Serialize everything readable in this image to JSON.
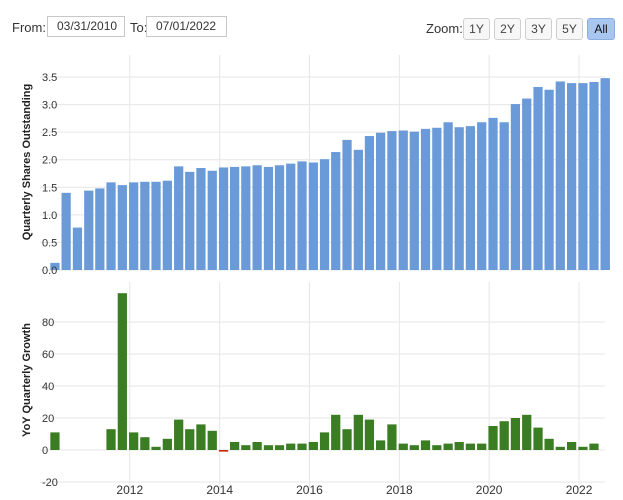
{
  "toolbar": {
    "from_label": "From:",
    "from_value": "03/31/2010",
    "to_label": "To:",
    "to_value": "07/01/2022",
    "zoom_label": "Zoom:",
    "zoom_buttons": [
      "1Y",
      "2Y",
      "3Y",
      "5Y",
      "All"
    ],
    "zoom_selected": "All"
  },
  "colors": {
    "shares_bar": "#6a9bd8",
    "growth_positive": "#3a7d22",
    "growth_negative": "#cc2200",
    "grid": "#e6e6e6"
  },
  "chart_data": [
    {
      "type": "bar",
      "ylabel": "Quarterly Shares Outstanding",
      "ylim": [
        0,
        3.9
      ],
      "yticks": [
        "0.0",
        "0.5",
        "1.0",
        "1.5",
        "2.0",
        "2.5",
        "3.0",
        "3.5"
      ],
      "x": [
        "2010-03-31",
        "2010-06-30",
        "2010-09-30",
        "2010-12-31",
        "2011-03-31",
        "2011-06-30",
        "2011-09-30",
        "2011-12-31",
        "2012-03-31",
        "2012-06-30",
        "2012-09-30",
        "2012-12-31",
        "2013-03-31",
        "2013-06-30",
        "2013-09-30",
        "2013-12-31",
        "2014-03-31",
        "2014-06-30",
        "2014-09-30",
        "2014-12-31",
        "2015-03-31",
        "2015-06-30",
        "2015-09-30",
        "2015-12-31",
        "2016-03-31",
        "2016-06-30",
        "2016-09-30",
        "2016-12-31",
        "2017-03-31",
        "2017-06-30",
        "2017-09-30",
        "2017-12-31",
        "2018-03-31",
        "2018-06-30",
        "2018-09-30",
        "2018-12-31",
        "2019-03-31",
        "2019-06-30",
        "2019-09-30",
        "2019-12-31",
        "2020-03-31",
        "2020-06-30",
        "2020-09-30",
        "2020-12-31",
        "2021-03-31",
        "2021-06-30",
        "2021-09-30",
        "2021-12-31",
        "2022-03-31",
        "2022-06-30"
      ],
      "values": [
        0.13,
        1.4,
        0.77,
        1.44,
        1.48,
        1.59,
        1.54,
        1.59,
        1.6,
        1.6,
        1.62,
        1.88,
        1.78,
        1.85,
        1.8,
        1.86,
        1.87,
        1.88,
        1.9,
        1.87,
        1.9,
        1.93,
        1.97,
        1.95,
        2.01,
        2.14,
        2.36,
        2.18,
        2.43,
        2.49,
        2.52,
        2.53,
        2.51,
        2.56,
        2.58,
        2.68,
        2.59,
        2.61,
        2.68,
        2.76,
        2.68,
        3.01,
        3.11,
        3.32,
        3.27,
        3.42,
        3.39,
        3.39,
        3.41,
        3.48,
        3.46
      ]
    },
    {
      "type": "bar",
      "ylabel": "YoY Quarterly Growth",
      "ylim": [
        -25,
        105
      ],
      "yticks": [
        "-20",
        "0",
        "20",
        "40",
        "60",
        "80"
      ],
      "xticks": [
        "2012",
        "2014",
        "2016",
        "2018",
        "2020",
        "2022"
      ],
      "x": [
        "2010-03-31",
        "2010-06-30",
        "2010-09-30",
        "2010-12-31",
        "2011-03-31",
        "2011-06-30",
        "2011-09-30",
        "2011-12-31",
        "2012-03-31",
        "2012-06-30",
        "2012-09-30",
        "2012-12-31",
        "2013-03-31",
        "2013-06-30",
        "2013-09-30",
        "2013-12-31",
        "2014-03-31",
        "2014-06-30",
        "2014-09-30",
        "2014-12-31",
        "2015-03-31",
        "2015-06-30",
        "2015-09-30",
        "2015-12-31",
        "2016-03-31",
        "2016-06-30",
        "2016-09-30",
        "2016-12-31",
        "2017-03-31",
        "2017-06-30",
        "2017-09-30",
        "2017-12-31",
        "2018-03-31",
        "2018-06-30",
        "2018-09-30",
        "2018-12-31",
        "2019-03-31",
        "2019-06-30",
        "2019-09-30",
        "2019-12-31",
        "2020-03-31",
        "2020-06-30",
        "2020-09-30",
        "2020-12-31",
        "2021-03-31",
        "2021-06-30",
        "2021-09-30",
        "2021-12-31",
        "2022-03-31",
        "2022-06-30"
      ],
      "values": [
        11,
        0,
        0,
        0,
        0,
        13,
        98,
        11,
        8,
        2,
        7,
        19,
        13,
        16,
        12,
        -1,
        5,
        3,
        5,
        3,
        3,
        4,
        4,
        5,
        11,
        22,
        13,
        22,
        19,
        6,
        16,
        4,
        3,
        6,
        3,
        4,
        5,
        4,
        4,
        15,
        18,
        20,
        22,
        14,
        7,
        2,
        5,
        2,
        4
      ]
    }
  ]
}
